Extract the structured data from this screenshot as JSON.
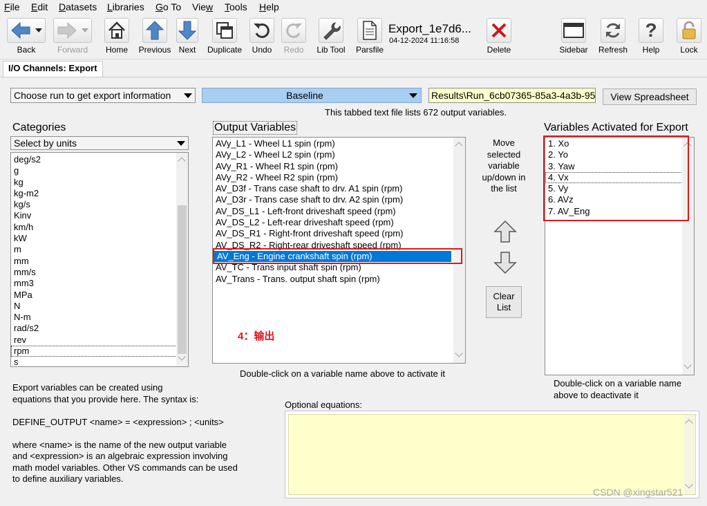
{
  "menu": [
    "File",
    "Edit",
    "Datasets",
    "Libraries",
    "Go To",
    "View",
    "Tools",
    "Help"
  ],
  "toolbar": {
    "back": "Back",
    "forward": "Forward",
    "home": "Home",
    "previous": "Previous",
    "next": "Next",
    "duplicate": "Duplicate",
    "undo": "Undo",
    "redo": "Redo",
    "lib_tool": "Lib Tool",
    "parsfile": "Parsfile",
    "doc_title": "Export_1e7d6...",
    "doc_date": "04-12-2024 11:16:58",
    "delete": "Delete",
    "sidebar": "Sidebar",
    "refresh": "Refresh",
    "help": "Help",
    "lock": "Lock"
  },
  "tab": "I/O Channels: Export",
  "run_combo": "Choose run to get export information",
  "baseline_combo": "Baseline",
  "results_path": "Results\\Run_6cb07365-85a3-4a3b-95",
  "view_spreadsheet": "View Spreadsheet",
  "info_text": "This tabbed text file lists 672 output variables.",
  "categories": {
    "heading": "Categories",
    "combo": "Select by units",
    "items": [
      "deg/s2",
      "g",
      "kg",
      "kg-m2",
      "kg/s",
      "Kinv",
      "km/h",
      "kW",
      "m",
      "mm",
      "mm/s",
      "mm3",
      "MPa",
      "N",
      "N-m",
      "rad/s2",
      "rev",
      "rpm",
      "s"
    ],
    "selected": "rpm"
  },
  "output_vars": {
    "heading": "Output Variables",
    "items": [
      "AVy_L1 - Wheel L1 spin (rpm)",
      "AVy_L2 - Wheel L2 spin (rpm)",
      "AVy_R1 - Wheel R1 spin (rpm)",
      "AVy_R2 - Wheel R2 spin (rpm)",
      "AV_D3f - Trans case shaft to drv. A1 spin (rpm)",
      "AV_D3r - Trans case shaft to drv. A2 spin (rpm)",
      "AV_DS_L1 - Left-front driveshaft speed (rpm)",
      "AV_DS_L2 - Left-rear driveshaft speed (rpm)",
      "AV_DS_R1 - Right-front driveshaft speed (rpm)",
      "AV_DS_R2 - Right-rear driveshaft speed (rpm)",
      "AV_Eng - Engine crankshaft spin (rpm)",
      "AV_TC - Trans input shaft spin (rpm)",
      "AV_Trans - Trans. output shaft spin (rpm)"
    ],
    "selected": "AV_Eng - Engine crankshaft spin (rpm)",
    "annotation": "4：输出",
    "hint": "Double-click on a variable name above to activate it"
  },
  "move": {
    "label": "Move selected variable up/down in the list",
    "clear": "Clear List"
  },
  "activated": {
    "heading": "Variables Activated for Export",
    "items": [
      "1. Xo",
      "2. Yo",
      "3. Yaw",
      "4. Vx",
      "5. Vy",
      "6. AVz",
      "7. AV_Eng"
    ],
    "hint": "Double-click on a variable name above to deactivate it"
  },
  "help_text": [
    "Export variables can be created using",
    "equations that you provide here. The syntax is:",
    "",
    "DEFINE_OUTPUT <name> = <expression> ; <units>",
    "",
    "where <name> is the name of the new output variable",
    "and <expression> is an algebraic expression involving",
    "math model variables. Other VS commands can be used",
    "to define auxiliary variables."
  ],
  "optional_label": "Optional equations:",
  "watermark": "CSDN @xingstar521",
  "colors": {
    "accent": "#0078d7",
    "annotation": "#e0161b",
    "equations_bg": "#ffffcc",
    "path_bg": "#ffffcc"
  }
}
